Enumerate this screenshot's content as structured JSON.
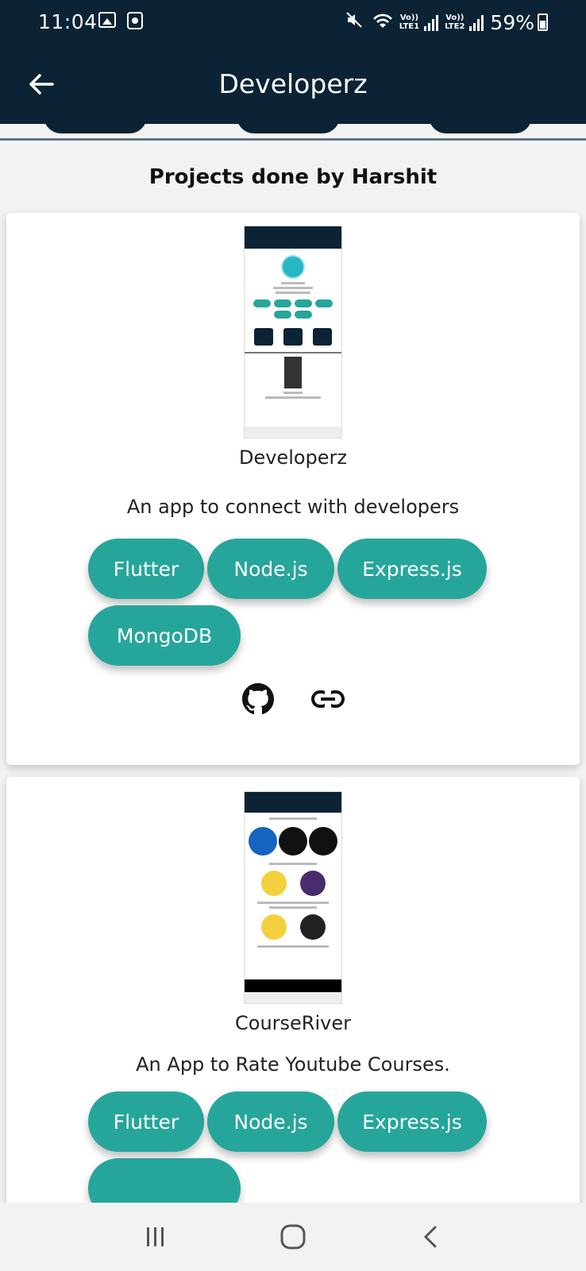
{
  "status_bar": {
    "time": "11:04",
    "battery": "59%",
    "network1": "Vo)) LTE1",
    "network2": "Vo)) LTE2"
  },
  "app_bar": {
    "title": "Developerz",
    "back_icon": "arrow-left-icon"
  },
  "section": {
    "title": "Projects done by Harshit"
  },
  "projects": [
    {
      "name": "Developerz",
      "description": "An app to connect with developers",
      "tags": [
        "Flutter",
        "Node.js",
        "Express.js",
        "MongoDB"
      ],
      "links": [
        "github-icon",
        "link-icon"
      ]
    },
    {
      "name": "CourseRiver",
      "description": "An App to Rate Youtube Courses.",
      "tags": [
        "Flutter",
        "Node.js",
        "Express.js",
        ""
      ]
    }
  ],
  "colors": {
    "primary_dark": "#0b2334",
    "chip_teal": "#26a69a",
    "background": "#f2f2f2"
  },
  "nav": {
    "recents": "recents-icon",
    "home": "home-icon",
    "back": "back-icon"
  }
}
